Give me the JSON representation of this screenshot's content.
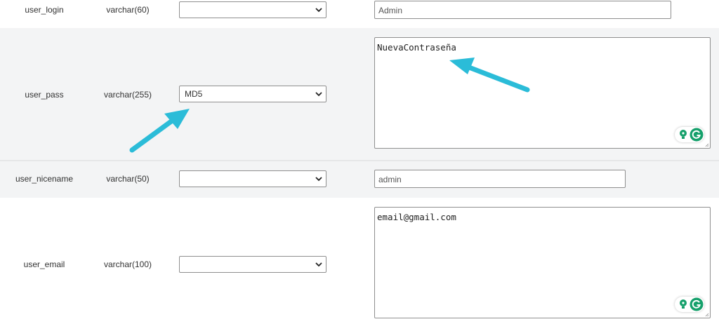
{
  "accent": "#2bbcd8",
  "grammar_color": "#15a06b",
  "rows": [
    {
      "field": "user_login",
      "type": "varchar(60)",
      "function": "",
      "value": "Admin",
      "editor": "input"
    },
    {
      "field": "user_pass",
      "type": "varchar(255)",
      "function": "MD5",
      "value": "NuevaContraseña",
      "editor": "textarea"
    },
    {
      "field": "user_nicename",
      "type": "varchar(50)",
      "function": "",
      "value": "admin",
      "editor": "input"
    },
    {
      "field": "user_email",
      "type": "varchar(100)",
      "function": "",
      "value": "email@gmail.com",
      "editor": "textarea"
    }
  ],
  "icons": {
    "dropdown": "chevron-down-icon",
    "grammar_suggestion": "lightbulb-icon",
    "grammar_logo": "grammarly-icon",
    "resize": "resize-handle-icon",
    "annotation": "arrow-annotation"
  }
}
